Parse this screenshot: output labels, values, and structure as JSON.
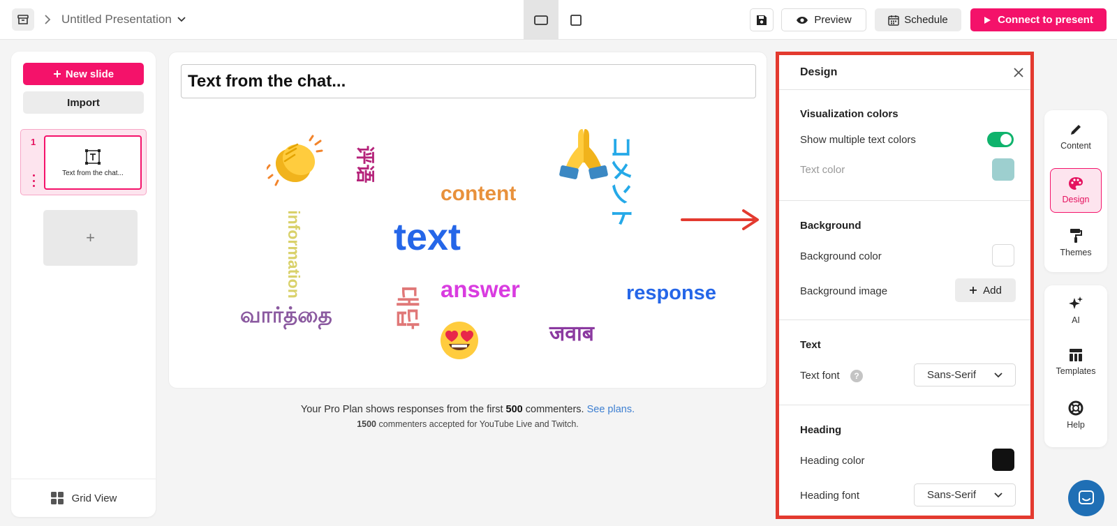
{
  "topbar": {
    "presentation_title": "Untitled Presentation",
    "preview_label": "Preview",
    "schedule_label": "Schedule",
    "connect_label": "Connect to present"
  },
  "left_panel": {
    "new_slide_label": "New slide",
    "import_label": "Import",
    "slides": [
      {
        "number": "1",
        "title": "Text from the chat..."
      }
    ],
    "add_slide_symbol": "+",
    "grid_view_label": "Grid View"
  },
  "canvas": {
    "slide_title": "Text from the chat...",
    "words": {
      "clap_emoji": "clapping-hands",
      "chinese": "评语",
      "information": "information",
      "tamil": "வார்த்தை",
      "content": "content",
      "text": "text",
      "korean": "대답",
      "answer": "answer",
      "heart_eyes_emoji": "heart-eyes",
      "pray_emoji": "folded-hands",
      "japanese": "コメント",
      "response": "response",
      "hindi": "जवाब"
    },
    "word_colors": {
      "chinese": "#b5237a",
      "information": "#d9d16a",
      "tamil": "#8b5aa0",
      "content": "#e8913c",
      "text": "#2566e8",
      "korean": "#e07878",
      "answer": "#d93ce0",
      "japanese": "#25a9e8",
      "response": "#2566e8",
      "hindi": "#8b3aa0"
    }
  },
  "plan_info": {
    "line1_prefix": "Your Pro Plan shows responses from the first",
    "line1_count": "500",
    "line1_suffix": "commenters.",
    "line1_link": "See plans.",
    "line2_count": "1500",
    "line2_suffix": "commenters accepted for YouTube Live and Twitch."
  },
  "design_panel": {
    "title": "Design",
    "visualization": {
      "section_title": "Visualization colors",
      "multi_colors_label": "Show multiple text colors",
      "multi_colors_on": true,
      "text_color_label": "Text color",
      "text_color": "#9dcfcf"
    },
    "background": {
      "section_title": "Background",
      "color_label": "Background color",
      "color": "#ffffff",
      "image_label": "Background image",
      "add_label": "Add"
    },
    "text": {
      "section_title": "Text",
      "font_label": "Text font",
      "font_value": "Sans-Serif"
    },
    "heading": {
      "section_title": "Heading",
      "color_label": "Heading color",
      "color": "#111111",
      "font_label": "Heading font",
      "font_value": "Sans-Serif"
    }
  },
  "rail": {
    "content_label": "Content",
    "design_label": "Design",
    "themes_label": "Themes",
    "ai_label": "AI",
    "templates_label": "Templates",
    "help_label": "Help"
  },
  "colors": {
    "accent": "#f4126a",
    "highlight_box": "#e33a2f",
    "toggle_on": "#0fb36c"
  }
}
